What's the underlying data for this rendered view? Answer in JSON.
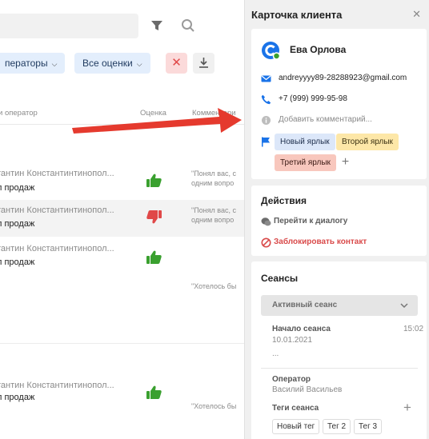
{
  "list": {
    "filters": {
      "operators_label": "ператоры",
      "ratings_label": "Все оценки"
    },
    "columns": {
      "operator": "и оператор",
      "rating": "Оценка",
      "comment": "Комментари"
    },
    "rows": [
      {
        "name": "тантин Константинтинопол...",
        "dept": "л продаж",
        "rating": "like",
        "comment_line1": "\"Понял вас, с",
        "comment_line2": "одним вопро"
      },
      {
        "name": "тантин Константинтинопол...",
        "dept": "л продаж",
        "rating": "dislike",
        "comment_line1": "\"Понял вас, с",
        "comment_line2": "одним вопро"
      },
      {
        "name": "тантин Константинтинопол...",
        "dept": "л продаж",
        "rating": "like",
        "comment_line1": "\"Хотелось бы",
        "comment_line2": ""
      },
      {
        "name": "тантин Константинтинопол...",
        "dept": "л продаж",
        "rating": "like",
        "comment_line1": "\"Хотелось бы",
        "comment_line2": ""
      }
    ]
  },
  "panel": {
    "title": "Карточка клиента",
    "close_icon": "close-icon",
    "client": {
      "name": "Ева Орлова",
      "email": "andreyyyy89-28288923@gmail.com",
      "phone": "+7 (999) 999-95-98",
      "comment_placeholder": "Добавить комментарий..."
    },
    "tags": [
      "Новый ярлык",
      "Второй ярлык",
      "Третий ярлык"
    ],
    "actions": {
      "title": "Действия",
      "go_to_dialog": "Перейти к диалогу",
      "block_contact": "Заблокировать контакт"
    },
    "sessions": {
      "title": "Сеансы",
      "active_label": "Активный сеанс",
      "start_label": "Начало сеанса",
      "start_date": "10.01.2021",
      "start_time": "15:02",
      "ellipsis": "...",
      "operator_label": "Оператор",
      "operator_name": "Василий Васильев",
      "tags_label": "Теги сеанса",
      "tags": [
        "Новый тег",
        "Тег 2",
        "Тег 3"
      ]
    }
  },
  "colors": {
    "accent_blue": "#1a73e8",
    "danger_red": "#d94a4a",
    "like_green": "#3aa02f",
    "dislike_red": "#e04848",
    "arrow_red": "#e53a2e"
  }
}
